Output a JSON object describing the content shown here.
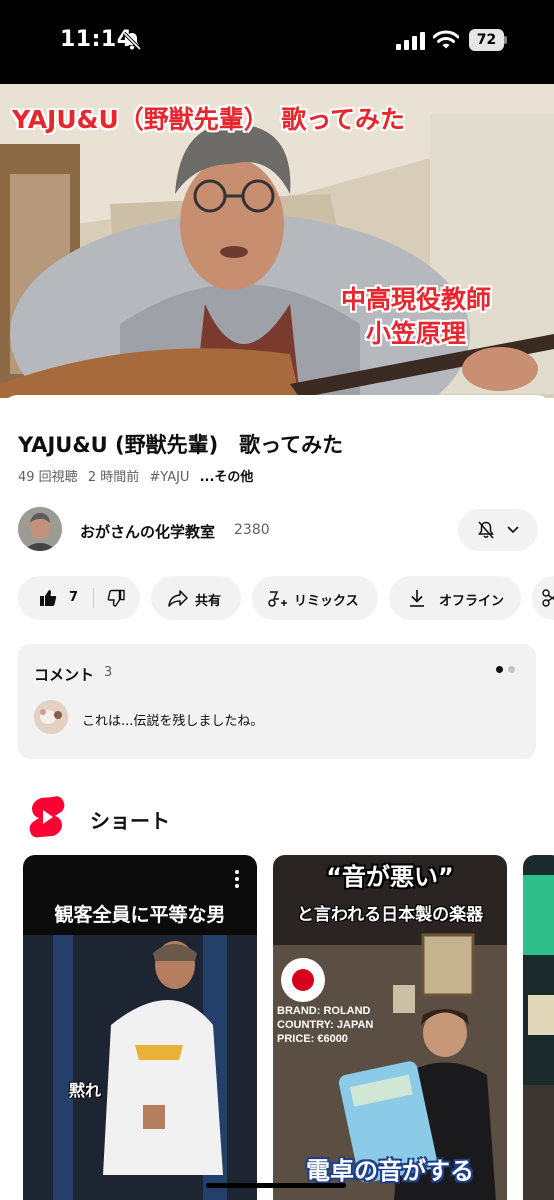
{
  "status_bar": {
    "time": "11:14",
    "battery": "72"
  },
  "video": {
    "overlay_title": "YAJU&U（野獣先輩）　歌ってみた",
    "overlay_line1": "中高現役教師",
    "overlay_line2": "小笠原理"
  },
  "title": "YAJU&U (野獣先輩)　歌ってみた",
  "meta": {
    "views": "49 回視聴",
    "age": "2 時間前",
    "hashtag": "#YAJU",
    "more": "...その他"
  },
  "channel": {
    "name": "おがさんの化学教室",
    "subscribers": "2380"
  },
  "actions": {
    "like_count": "7",
    "share": "共有",
    "remix": "リミックス",
    "offline": "オフライン"
  },
  "comments": {
    "title": "コメント",
    "count": "3",
    "top_comment": "これは...伝説を残しましたね。"
  },
  "shorts": {
    "label": "ショート",
    "items": [
      {
        "headline": "観客全員に平等な男",
        "caption": "黙れ"
      },
      {
        "headline_top": "“音が悪い”",
        "headline_line2": "と言われる日本製の楽器",
        "brand_lines": [
          "BRAND: ROLAND",
          "COUNTRY: JAPAN",
          "PRICE: €6000"
        ],
        "bottom_caption": "電卓の音がする"
      }
    ]
  },
  "colors": {
    "accent_red": "#e8262e",
    "shorts_red": "#ff0033",
    "pill_bg": "#f2f2f2"
  }
}
